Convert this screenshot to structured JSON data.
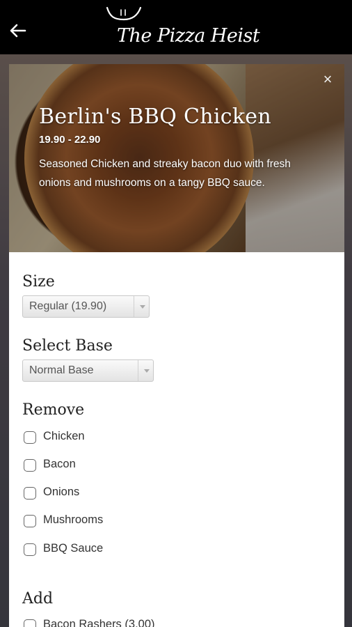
{
  "header": {
    "back_icon": "arrow-left-icon",
    "logo_text": "The Pizza Heist"
  },
  "product": {
    "title": "Berlin's BBQ Chicken",
    "price_range": "19.90 - 22.90",
    "description": "Seasoned Chicken and streaky bacon duo with fresh onions and mushrooms on a tangy BBQ sauce.",
    "close_icon": "close-icon"
  },
  "size": {
    "label": "Size",
    "selected": "Regular (19.90)"
  },
  "base": {
    "label": "Select Base",
    "selected": "Normal Base"
  },
  "remove": {
    "label": "Remove",
    "options": [
      {
        "label": "Chicken",
        "checked": false
      },
      {
        "label": "Bacon",
        "checked": false
      },
      {
        "label": "Onions",
        "checked": false
      },
      {
        "label": "Mushrooms",
        "checked": false
      },
      {
        "label": "BBQ Sauce",
        "checked": false
      }
    ]
  },
  "add": {
    "label": "Add",
    "options": [
      {
        "label": "Bacon Rashers (3.00)",
        "checked": false
      }
    ]
  }
}
